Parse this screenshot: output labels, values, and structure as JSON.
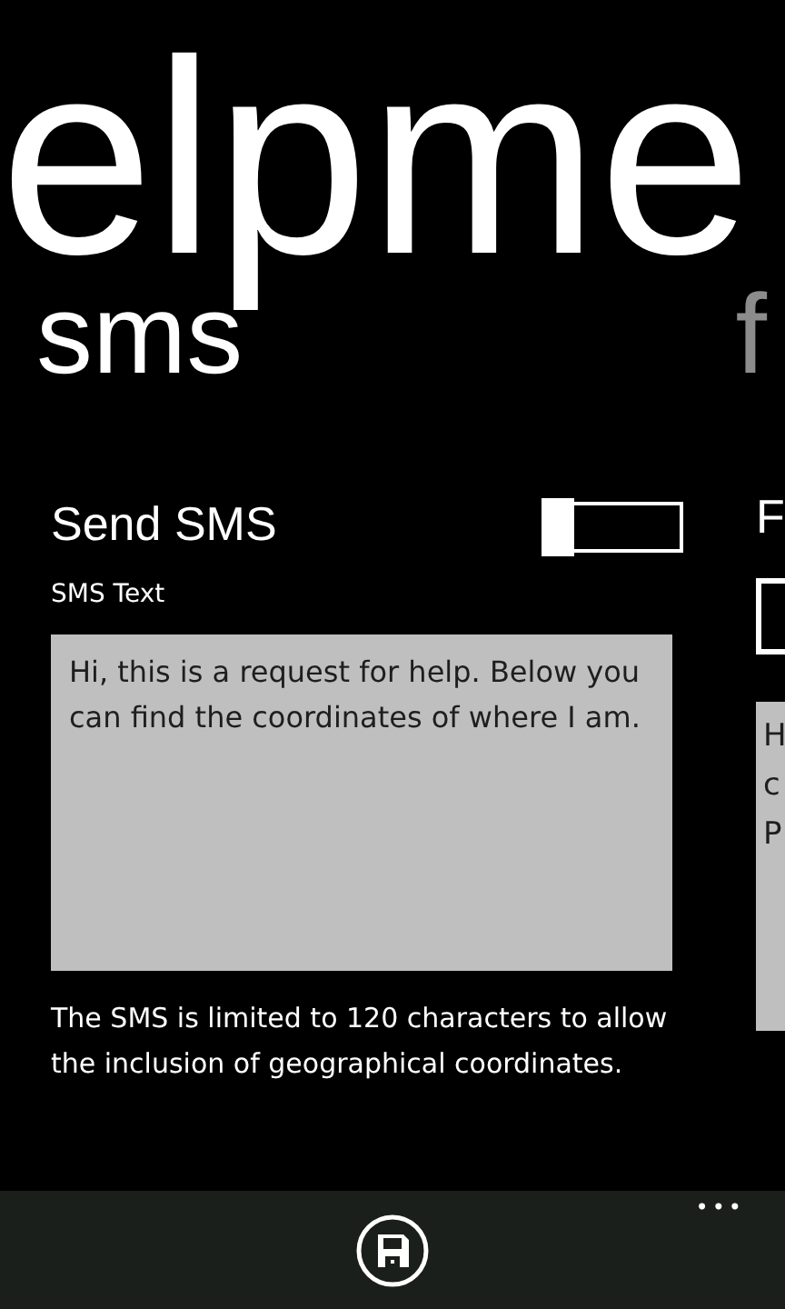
{
  "app_title": "elpme",
  "pivot_headers": [
    {
      "label": "sms",
      "selected": true
    },
    {
      "label": "f",
      "selected": false
    }
  ],
  "sms": {
    "toggle_label": "Send SMS",
    "enabled": false,
    "field_label": "SMS Text",
    "text": "Hi, this is a request for help. Below you can find the coordinates of where I am.",
    "note": "The SMS is limited to 120 characters to allow the inclusion of geographical coordinates."
  },
  "next_panel": {
    "toggle_label": "F",
    "checked": false,
    "text_lines": [
      "H",
      "c",
      "P"
    ]
  },
  "app_bar": {
    "buttons": [
      {
        "kind": "save"
      }
    ],
    "more": "•••"
  }
}
